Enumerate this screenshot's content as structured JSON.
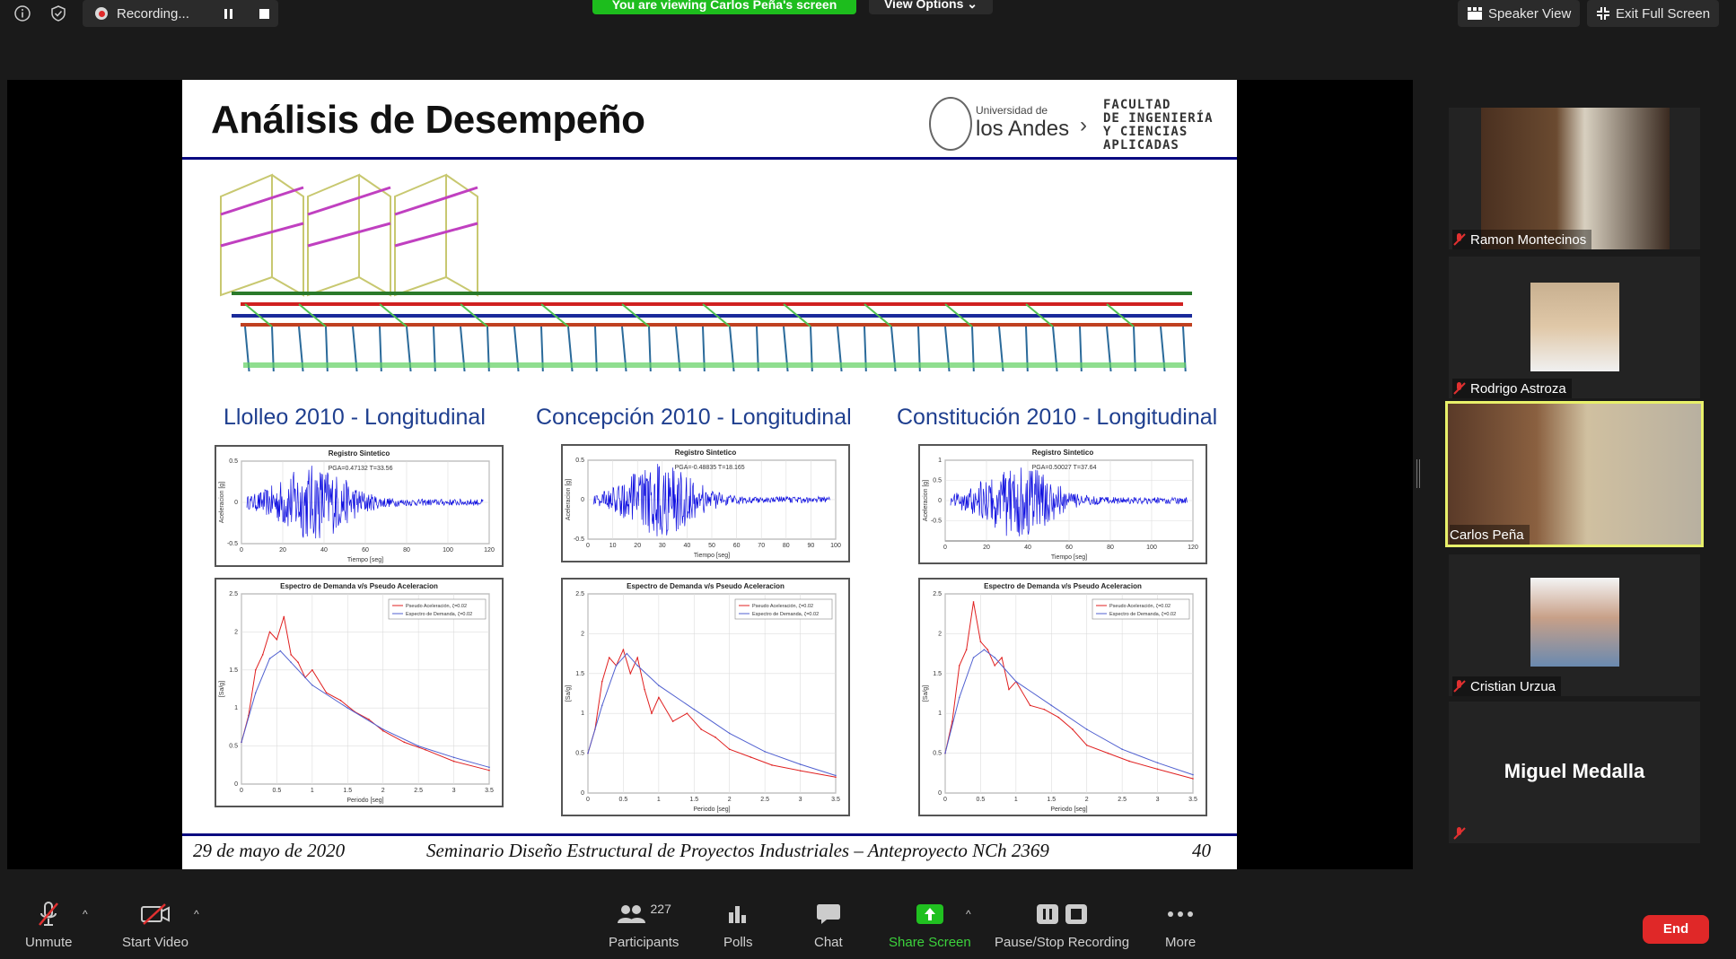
{
  "topbar": {
    "recording_label": "Recording...",
    "viewing_banner": "You are viewing Carlos Peña's screen",
    "view_options": "View Options",
    "speaker_view": "Speaker View",
    "exit_full_screen": "Exit Full Screen"
  },
  "slide": {
    "title": "Análisis de Desempeño",
    "logo_small": "Universidad de",
    "logo_big": "los Andes",
    "faculty": [
      "FACULTAD",
      "DE INGENIERÍA",
      "Y CIENCIAS",
      "APLICADAS"
    ],
    "chart_titles": [
      "Llolleo 2010 - Longitudinal",
      "Concepción 2010 - Longitudinal",
      "Constitución 2010 - Longitudinal"
    ],
    "footer_date": "29 de mayo de 2020",
    "footer_title": "Seminario Diseño Estructural de Proyectos Industriales – Anteproyecto NCh 2369",
    "page_number": "40"
  },
  "chart_data": [
    {
      "type": "line",
      "title": "Registro Sintetico",
      "xlabel": "Tiempo [seg]",
      "ylabel": "Aceleracion [g]",
      "xlim": [
        0,
        120
      ],
      "ylim": [
        -0.5,
        0.5
      ],
      "xticks": [
        "0",
        "20",
        "40",
        "60",
        "80",
        "100",
        "120"
      ],
      "yticks": [
        "0.5",
        "0",
        "-0.5"
      ],
      "annotation": "PGA=0.47132  T=33.56",
      "color": "#1010e0",
      "grid": true
    },
    {
      "type": "line",
      "title": "Registro Sintetico",
      "xlabel": "Tiempo [seg]",
      "ylabel": "Aceleracion [g]",
      "xlim": [
        0,
        100
      ],
      "ylim": [
        -0.5,
        0.5
      ],
      "xticks": [
        "0",
        "10",
        "20",
        "30",
        "40",
        "50",
        "60",
        "70",
        "80",
        "90",
        "100"
      ],
      "yticks": [
        "0.5",
        "0",
        "-0.5"
      ],
      "annotation": "PGA=-0.48835  T=18.165",
      "color": "#1010e0",
      "grid": true
    },
    {
      "type": "line",
      "title": "Registro Sintetico",
      "xlabel": "Tiempo [seg]",
      "ylabel": "Aceleracion [g]",
      "xlim": [
        0,
        120
      ],
      "ylim": [
        -1,
        1
      ],
      "xticks": [
        "0",
        "20",
        "40",
        "60",
        "80",
        "100",
        "120"
      ],
      "yticks": [
        "1",
        "0.5",
        "0",
        "-0.5"
      ],
      "annotation": "PGA=0.50027  T=37.64",
      "color": "#1010e0",
      "grid": true
    },
    {
      "type": "line",
      "title": "Espectro de Demanda v/s Pseudo Aceleracion",
      "xlabel": "Periodo [seg]",
      "ylabel": "[Sa/g]",
      "xlim": [
        0,
        3.5
      ],
      "ylim": [
        0,
        2.5
      ],
      "xticks": [
        "0",
        "0.5",
        "1",
        "1.5",
        "2",
        "2.5",
        "3",
        "3.5"
      ],
      "yticks": [
        "2.5",
        "2",
        "1.5",
        "1",
        "0.5",
        "0"
      ],
      "legend_position": "top-right",
      "series": [
        {
          "name": "Pseudo Aceleración, ζ=0.02",
          "color": "#e02020",
          "x": [
            0,
            0.1,
            0.2,
            0.3,
            0.4,
            0.5,
            0.6,
            0.7,
            0.8,
            0.9,
            1.0,
            1.2,
            1.4,
            1.6,
            1.8,
            2.0,
            2.3,
            2.6,
            3.0,
            3.5
          ],
          "y": [
            0.55,
            0.9,
            1.5,
            1.7,
            2.0,
            1.9,
            2.2,
            1.7,
            1.6,
            1.4,
            1.5,
            1.2,
            1.1,
            0.95,
            0.85,
            0.7,
            0.55,
            0.45,
            0.3,
            0.18
          ]
        },
        {
          "name": "Espectro de Demanda, ζ=0.02",
          "color": "#5060d0",
          "x": [
            0,
            0.2,
            0.4,
            0.55,
            0.7,
            1.0,
            1.5,
            2.0,
            2.5,
            3.0,
            3.5
          ],
          "y": [
            0.55,
            1.2,
            1.65,
            1.75,
            1.6,
            1.3,
            1.0,
            0.72,
            0.5,
            0.35,
            0.22
          ]
        }
      ]
    },
    {
      "type": "line",
      "title": "Espectro de Demanda v/s Pseudo Aceleracion",
      "xlabel": "Periodo [seg]",
      "ylabel": "[Sa/g]",
      "xlim": [
        0,
        3.5
      ],
      "ylim": [
        0,
        2.5
      ],
      "xticks": [
        "0",
        "0.5",
        "1",
        "1.5",
        "2",
        "2.5",
        "3",
        "3.5"
      ],
      "yticks": [
        "2.5",
        "2",
        "1.5",
        "1",
        "0.5",
        "0"
      ],
      "legend_position": "top-right",
      "series": [
        {
          "name": "Pseudo Aceleración, ζ=0.02",
          "color": "#e02020",
          "x": [
            0,
            0.1,
            0.2,
            0.3,
            0.4,
            0.5,
            0.6,
            0.7,
            0.8,
            0.9,
            1.0,
            1.2,
            1.4,
            1.6,
            1.8,
            2.0,
            2.3,
            2.6,
            3.0,
            3.5
          ],
          "y": [
            0.5,
            0.8,
            1.4,
            1.7,
            1.6,
            1.8,
            1.5,
            1.7,
            1.3,
            1.0,
            1.2,
            0.9,
            1.0,
            0.8,
            0.7,
            0.55,
            0.45,
            0.35,
            0.28,
            0.2
          ]
        },
        {
          "name": "Espectro de Demanda, ζ=0.02",
          "color": "#5060d0",
          "x": [
            0,
            0.2,
            0.4,
            0.55,
            0.7,
            1.0,
            1.5,
            2.0,
            2.5,
            3.0,
            3.5
          ],
          "y": [
            0.5,
            1.1,
            1.6,
            1.75,
            1.6,
            1.35,
            1.05,
            0.75,
            0.52,
            0.36,
            0.22
          ]
        }
      ]
    },
    {
      "type": "line",
      "title": "Espectro de Demanda v/s Pseudo Aceleracion",
      "xlabel": "Periodo [seg]",
      "ylabel": "[Sa/g]",
      "xlim": [
        0,
        3.5
      ],
      "ylim": [
        0,
        2.5
      ],
      "xticks": [
        "0",
        "0.5",
        "1",
        "1.5",
        "2",
        "2.5",
        "3",
        "3.5"
      ],
      "yticks": [
        "2.5",
        "2",
        "1.5",
        "1",
        "0.5",
        "0"
      ],
      "legend_position": "top-right",
      "series": [
        {
          "name": "Pseudo Aceleración, ζ=0.02",
          "color": "#e02020",
          "x": [
            0,
            0.1,
            0.2,
            0.3,
            0.4,
            0.5,
            0.6,
            0.7,
            0.8,
            0.9,
            1.0,
            1.2,
            1.4,
            1.6,
            1.8,
            2.0,
            2.3,
            2.6,
            3.0,
            3.5
          ],
          "y": [
            0.5,
            0.9,
            1.6,
            1.8,
            2.4,
            1.9,
            1.8,
            1.6,
            1.7,
            1.3,
            1.4,
            1.1,
            1.05,
            0.95,
            0.8,
            0.6,
            0.5,
            0.4,
            0.3,
            0.18
          ]
        },
        {
          "name": "Espectro de Demanda, ζ=0.02",
          "color": "#5060d0",
          "x": [
            0,
            0.2,
            0.4,
            0.55,
            0.7,
            1.0,
            1.5,
            2.0,
            2.5,
            3.0,
            3.5
          ],
          "y": [
            0.5,
            1.2,
            1.7,
            1.8,
            1.7,
            1.4,
            1.1,
            0.8,
            0.55,
            0.38,
            0.23
          ]
        }
      ]
    }
  ],
  "participants_panel": [
    {
      "name": "Ramon Montecinos"
    },
    {
      "name": "Rodrigo Astroza"
    },
    {
      "name": "Carlos Peña"
    },
    {
      "name": "Cristian Urzua"
    },
    {
      "name": "Miguel Medalla"
    }
  ],
  "toolbar": {
    "unmute": "Unmute",
    "start_video": "Start Video",
    "participants": "Participants",
    "participants_count": "227",
    "polls": "Polls",
    "chat": "Chat",
    "share_screen": "Share Screen",
    "pause_stop_recording": "Pause/Stop Recording",
    "more": "More",
    "end": "End"
  },
  "colors": {
    "accent_green": "#1dbd1d",
    "end_red": "#e02828",
    "slide_title_blue": "#1f3f8f",
    "rule_navy": "#0a0a80",
    "active_speaker_border": "#e8f06a"
  }
}
